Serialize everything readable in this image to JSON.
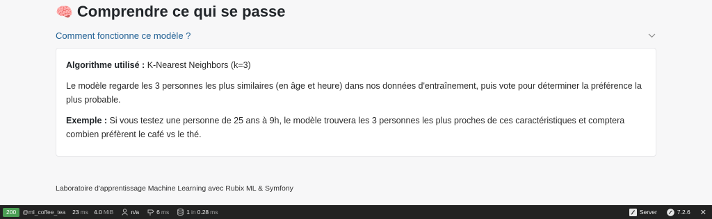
{
  "header": {
    "emoji": "🧠",
    "title": "Comprendre ce qui se passe"
  },
  "accordion": {
    "label": "Comment fonctionne ce modèle ?",
    "algo_label": "Algorithme utilisé :",
    "algo_value": "K-Nearest Neighbors (k=3)",
    "description": "Le modèle regarde les 3 personnes les plus similaires (en âge et heure) dans nos données d'entraînement, puis vote pour déterminer la préférence la plus probable.",
    "example_label": "Exemple :",
    "example_text": "Si vous testez une personne de 25 ans à 9h, le modèle trouvera les 3 personnes les plus proches de ces caractéristiques et comptera combien préfèrent le café vs le thé."
  },
  "footer": {
    "text": "Laboratoire d'apprentissage Machine Learning avec Rubix ML & Symfony"
  },
  "debug_toolbar": {
    "status": "200",
    "route": "@ml_coffee_tea",
    "time_value": "23",
    "time_unit": "ms",
    "memory_value": "4.0",
    "memory_unit": "MiB",
    "user": "n/a",
    "events_value": "6",
    "events_unit": "ms",
    "db_queries": "1",
    "db_in": "in",
    "db_time": "0.28",
    "db_unit": "ms",
    "server_label": "Server",
    "php_version": "7.2.6",
    "close": "✕"
  },
  "colors": {
    "accent": "#1f5f93",
    "status_ok": "#4b9e54",
    "toolbar_bg": "#222222"
  }
}
